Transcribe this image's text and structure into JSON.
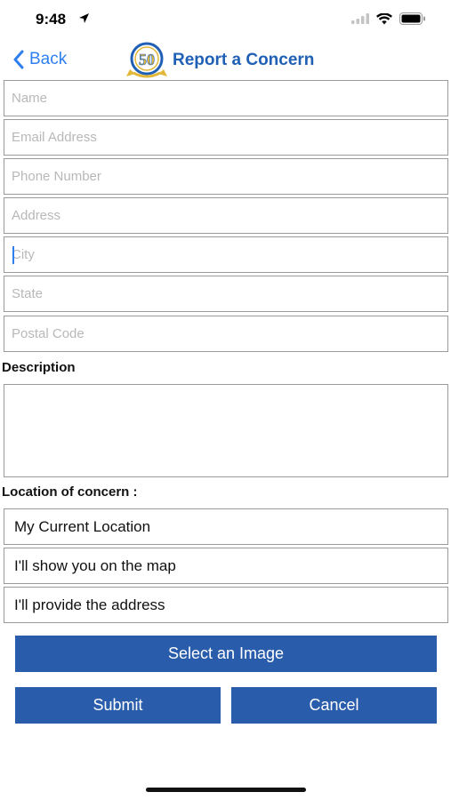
{
  "status": {
    "time": "9:48"
  },
  "nav": {
    "back_label": "Back",
    "title": "Report a Concern",
    "logo_text": "50"
  },
  "form": {
    "name_placeholder": "Name",
    "email_placeholder": "Email Address",
    "phone_placeholder": "Phone Number",
    "address_placeholder": "Address",
    "city_placeholder": "City",
    "state_placeholder": "State",
    "postal_placeholder": "Postal Code"
  },
  "description": {
    "label": "Description"
  },
  "location": {
    "label": "Location of concern :",
    "options": [
      "My Current Location",
      "I'll show you on the map",
      "I'll provide the address"
    ]
  },
  "actions": {
    "select_image": "Select an Image",
    "submit": "Submit",
    "cancel": "Cancel"
  },
  "colors": {
    "accent": "#2f7ff0",
    "button": "#2a5cac",
    "title": "#1f5fb5",
    "border": "#9a9a9a"
  }
}
